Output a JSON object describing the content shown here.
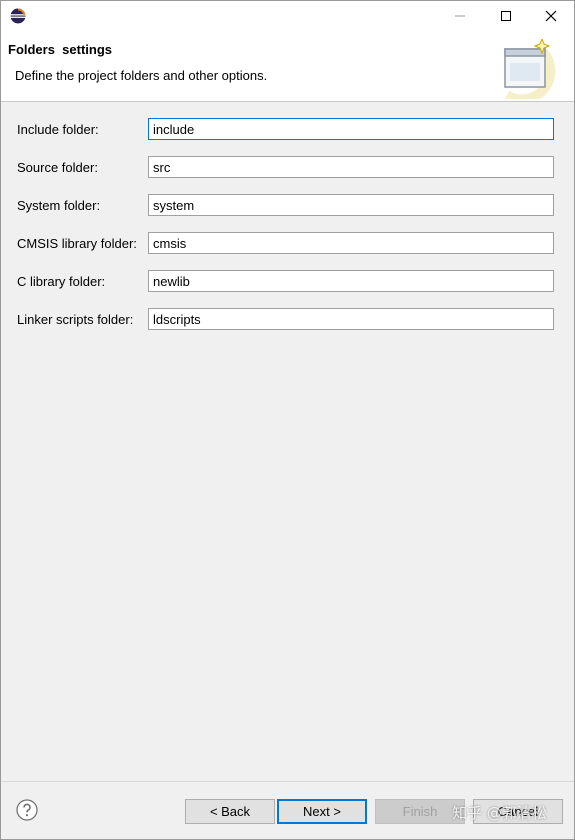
{
  "window": {
    "minimize_icon": "minimize-icon",
    "maximize_icon": "maximize-icon",
    "close_icon": "close-icon"
  },
  "header": {
    "title": "Folders  settings",
    "description": "Define the project folders and other options."
  },
  "fields": [
    {
      "label": "Include folder:",
      "value": "include"
    },
    {
      "label": "Source folder:",
      "value": "src"
    },
    {
      "label": "System folder:",
      "value": "system"
    },
    {
      "label": "CMSIS library folder:",
      "value": "cmsis"
    },
    {
      "label": "C library folder:",
      "value": "newlib"
    },
    {
      "label": "Linker scripts folder:",
      "value": "ldscripts"
    }
  ],
  "buttons": {
    "back": "< Back",
    "next": "Next >",
    "finish": "Finish",
    "cancel": "Cancel"
  },
  "watermark": "知乎 @郭清松",
  "colors": {
    "focus_accent": "#0078d7",
    "dialog_background": "#f0f0f0",
    "header_background": "#ffffff"
  }
}
